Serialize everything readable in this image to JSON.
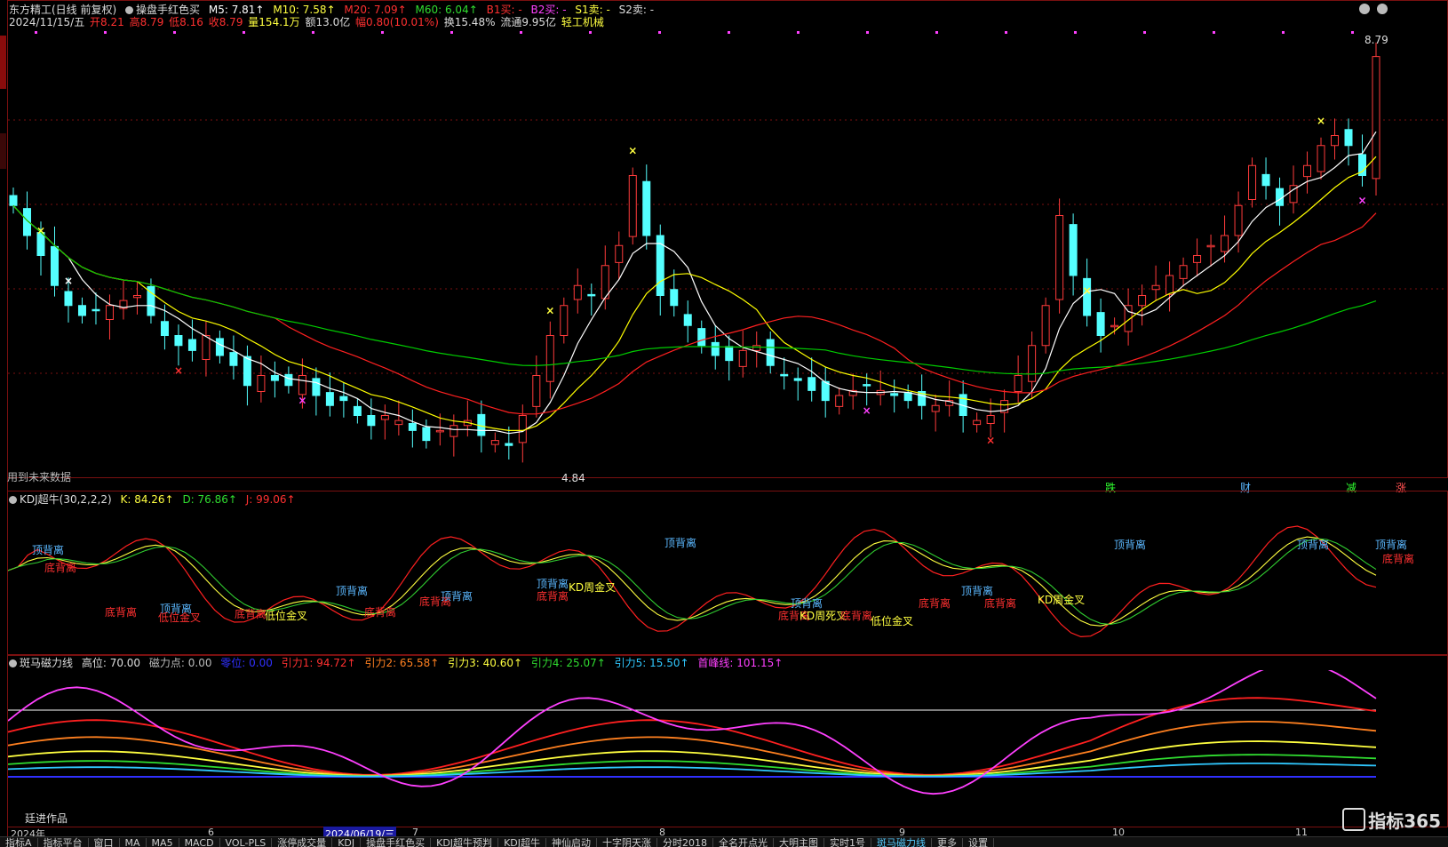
{
  "colors": {
    "up": "#ff3b3b",
    "down": "#54ffff",
    "ma5": "#ffffff",
    "ma10": "#ffff00",
    "ma20": "#ff2020",
    "ma60": "#00cc00",
    "magenta": "#ff40ff",
    "grid": "#7a1010"
  },
  "price_header": {
    "title": "东方精工(日线 前复权)",
    "indicator": "操盘手红色买",
    "m5": "M5: 7.81↑",
    "m10": "M10: 7.58↑",
    "m20": "M20: 7.09↑",
    "m60": "M60: 6.04↑",
    "b1": "B1买: -",
    "b2": "B2买: -",
    "s1": "S1卖: -",
    "s2": "S2卖: -"
  },
  "info_line": {
    "date": "2024/11/15/五",
    "open": "开8.21",
    "high": "高8.79",
    "low": "低8.16",
    "close": "收8.79",
    "volume": "量154.1万",
    "amount": "额13.0亿",
    "change": "幅0.80(10.01%)",
    "turnover": "换15.48%",
    "float": "流通9.95亿",
    "sector": "轻工机械"
  },
  "price_labels": {
    "high_mark": "8.79",
    "low_mark": "4.84",
    "future_note": "用到未来数据",
    "signals": [
      "跌",
      "财",
      "减",
      "涨"
    ]
  },
  "kdj_header": {
    "name": "KDJ超牛(30,2,2,2)",
    "k": "K: 84.26↑",
    "d": "D: 76.86↑",
    "j": "J: 99.06↑"
  },
  "kdj_annotations": [
    {
      "text": "顶背离",
      "color": "#5bb8ff"
    },
    {
      "text": "底背离",
      "color": "#ff3030"
    },
    {
      "text": "底背离",
      "color": "#ff3030"
    },
    {
      "text": "顶背离",
      "color": "#5bb8ff"
    },
    {
      "text": "低位金叉",
      "color": "#ff3030"
    },
    {
      "text": "底背离",
      "color": "#ff3030"
    },
    {
      "text": "低位金叉",
      "color": "#ffff40"
    },
    {
      "text": "顶背离",
      "color": "#5bb8ff"
    },
    {
      "text": "底背离",
      "color": "#ff3030"
    },
    {
      "text": "底背离",
      "color": "#ff3030"
    },
    {
      "text": "顶背离",
      "color": "#5bb8ff"
    },
    {
      "text": "顶背离",
      "color": "#5bb8ff"
    },
    {
      "text": "底背离",
      "color": "#ff3030"
    },
    {
      "text": "KD周金叉",
      "color": "#ffff40"
    },
    {
      "text": "顶背离",
      "color": "#5bb8ff"
    },
    {
      "text": "顶背离",
      "color": "#5bb8ff"
    },
    {
      "text": "底背离",
      "color": "#ff3030"
    },
    {
      "text": "KD周死叉",
      "color": "#ffff40"
    },
    {
      "text": "底背离",
      "color": "#ff3030"
    },
    {
      "text": "低位金叉",
      "color": "#ffff40"
    },
    {
      "text": "底背离",
      "color": "#ff3030"
    },
    {
      "text": "顶背离",
      "color": "#5bb8ff"
    },
    {
      "text": "底背离",
      "color": "#ff3030"
    },
    {
      "text": "KD周金叉",
      "color": "#ffff40"
    },
    {
      "text": "顶背离",
      "color": "#5bb8ff"
    },
    {
      "text": "顶背离",
      "color": "#5bb8ff"
    },
    {
      "text": "顶背离",
      "color": "#5bb8ff"
    },
    {
      "text": "底背离",
      "color": "#ff3030"
    }
  ],
  "zebra_header": {
    "name": "斑马磁力线",
    "high": "高位: 70.00",
    "magnet": "磁力点: 0.00",
    "zero": "零位: 0.00",
    "g1": "引力1: 94.72↑",
    "g2": "引力2: 65.58↑",
    "g3": "引力3: 40.60↑",
    "g4": "引力4: 25.07↑",
    "g5": "引力5: 15.50↑",
    "peak": "首峰线: 101.15↑"
  },
  "zebra_note": "廷进作品",
  "time_axis": [
    "2024年",
    "6",
    "2024/06/19/三",
    "7",
    "8",
    "9",
    "10",
    "11"
  ],
  "bottom_tabs": [
    "指标A",
    "指标平台",
    "窗口",
    "MA",
    "MA5",
    "MACD",
    "VOL-PLS",
    "涨停成交量",
    "KDJ",
    "操盘手红色买",
    "KDJ超牛预判",
    "KDJ超牛",
    "神仙启动",
    "十字阴天涨",
    "分时2018",
    "全名开点光",
    "大明主图",
    "实时1号",
    "斑马磁力线",
    "更多",
    "设置"
  ],
  "logo": "指标365",
  "chart_data": [
    {
      "type": "candlestick",
      "title": "东方精工(日线 前复权)",
      "series": [
        {
          "name": "M5",
          "last": 7.81
        },
        {
          "name": "M10",
          "last": 7.58
        },
        {
          "name": "M20",
          "last": 7.09
        },
        {
          "name": "M60",
          "last": 6.04
        }
      ],
      "ohlc_last": {
        "open": 8.21,
        "high": 8.79,
        "low": 8.16,
        "close": 8.79
      },
      "marks": {
        "high": 8.79,
        "low": 4.84
      },
      "ylim": [
        4.6,
        9.0
      ],
      "closes": [
        7.3,
        7.0,
        6.8,
        6.5,
        6.3,
        6.2,
        6.25,
        6.3,
        6.35,
        6.4,
        6.2,
        6.0,
        5.9,
        5.85,
        6.0,
        5.8,
        5.7,
        5.5,
        5.6,
        5.55,
        5.5,
        5.6,
        5.4,
        5.3,
        5.35,
        5.2,
        5.1,
        5.2,
        5.15,
        5.05,
        4.95,
        5.05,
        5.1,
        5.15,
        5.0,
        4.95,
        4.9,
        5.2,
        5.6,
        6.0,
        6.3,
        6.5,
        6.4,
        6.7,
        6.9,
        7.6,
        7.0,
        6.4,
        6.3,
        6.1,
        5.9,
        5.8,
        5.75,
        5.85,
        5.9,
        5.7,
        5.6,
        5.55,
        5.45,
        5.35,
        5.4,
        5.45,
        5.5,
        5.45,
        5.4,
        5.35,
        5.3,
        5.3,
        5.35,
        5.2,
        5.15,
        5.2,
        5.35,
        5.6,
        5.9,
        6.3,
        7.2,
        6.6,
        6.2,
        6.0,
        6.1,
        6.3,
        6.4,
        6.5,
        6.6,
        6.7,
        6.8,
        6.9,
        7.0,
        7.3,
        7.7,
        7.5,
        7.3,
        7.5,
        7.7,
        7.9,
        8.0,
        7.9,
        7.6,
        8.79
      ]
    },
    {
      "type": "line",
      "title": "KDJ超牛(30,2,2,2)",
      "series": [
        {
          "name": "K",
          "last": 84.26
        },
        {
          "name": "D",
          "last": 76.86
        },
        {
          "name": "J",
          "last": 99.06
        }
      ]
    },
    {
      "type": "line",
      "title": "斑马磁力线",
      "series": [
        {
          "name": "高位",
          "last": 70.0
        },
        {
          "name": "磁力点",
          "last": 0.0
        },
        {
          "name": "零位",
          "last": 0.0
        },
        {
          "name": "引力1",
          "last": 94.72
        },
        {
          "name": "引力2",
          "last": 65.58
        },
        {
          "name": "引力3",
          "last": 40.6
        },
        {
          "name": "引力4",
          "last": 25.07
        },
        {
          "name": "引力5",
          "last": 15.5
        },
        {
          "name": "首峰线",
          "last": 101.15
        }
      ]
    }
  ]
}
